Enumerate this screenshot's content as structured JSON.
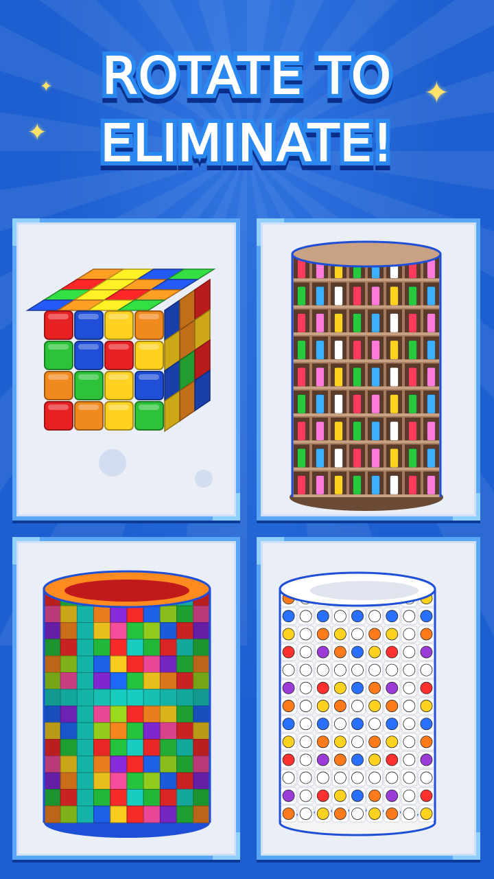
{
  "header": {
    "title_line1": "ROTATE TO",
    "title_line2": "ELIMINATE!"
  },
  "decor": {
    "sparkle_glyph": "✦"
  },
  "colors": {
    "background": "#1d5fd0",
    "card_border": "#5aa6f5",
    "card_fill": "#e9eef7",
    "title_outline": "#2a88f0",
    "sparkle": "#ffe26a"
  },
  "panels": [
    {
      "name": "cube-puzzle",
      "icon": "rubiks-cube-icon"
    },
    {
      "name": "grocery-shelf-tower",
      "icon": "shelf-tower-icon"
    },
    {
      "name": "color-block-tower",
      "icon": "block-tower-icon"
    },
    {
      "name": "ball-tile-tower",
      "icon": "ball-tower-icon"
    }
  ]
}
